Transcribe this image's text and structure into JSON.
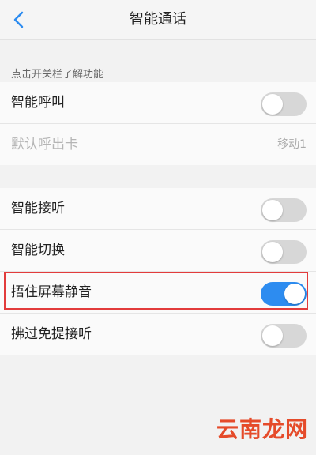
{
  "header": {
    "title": "智能通话",
    "back_icon": "chevron-left-icon"
  },
  "hint": "点击开关栏了解功能",
  "group1": [
    {
      "label": "智能呼叫",
      "toggle_on": false
    },
    {
      "label": "默认呼出卡",
      "value": "移动1",
      "disabled": true
    }
  ],
  "group2": [
    {
      "label": "智能接听",
      "toggle_on": false
    },
    {
      "label": "智能切换",
      "toggle_on": false
    },
    {
      "label": "捂住屏幕静音",
      "toggle_on": true
    },
    {
      "label": "拂过免提接听",
      "toggle_on": false
    }
  ],
  "colors": {
    "accent": "#2d8cf0",
    "highlight_border": "#e23b3b",
    "toggle_off": "#d7d7d7"
  },
  "watermark": "云南龙网"
}
